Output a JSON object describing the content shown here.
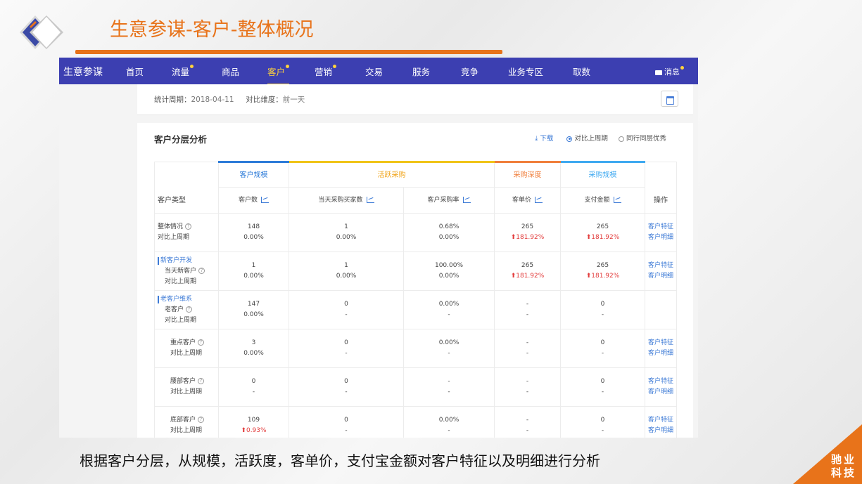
{
  "slide": {
    "title": "生意参谋-客户-整体概况",
    "caption": "根据客户分层，从规模，活跃度，客单价，支付宝金额对客户特征以及明细进行分析",
    "corner_line1": "驰业",
    "corner_line2": "科技",
    "accent_color": "#e8731a"
  },
  "nav": {
    "brand": "生意参谋",
    "items": [
      "首页",
      "流量",
      "商品",
      "客户",
      "营销",
      "交易",
      "服务",
      "竞争",
      "业务专区",
      "取数"
    ],
    "active": "客户",
    "message": "消息",
    "bg_color": "#3c3fb1"
  },
  "period": {
    "label": "统计周期：",
    "value": "2018-04-11",
    "compare_label": "对比维度：",
    "compare_value": "前一天"
  },
  "panel": {
    "title": "客户分层分析",
    "download": "下载",
    "radio_1": "对比上周期",
    "radio_2": "同行同层优秀"
  },
  "table": {
    "groups": [
      "客户规模",
      "活跃采购",
      "采购深度",
      "采购规模"
    ],
    "type_header": "客户类型",
    "ops_header": "操作",
    "columns": [
      "客户数",
      "当天采购买家数",
      "客户采购率",
      "客单价",
      "支付金额"
    ],
    "rows": [
      {
        "cat": "",
        "name": "整体情况",
        "sub": "对比上周期",
        "c1": "148",
        "c1b": "0.00%",
        "c2": "1",
        "c2b": "0.00%",
        "c3": "0.68%",
        "c3b": "0.00%",
        "c4": "265",
        "c4b": "181.92%",
        "c5": "265",
        "c5b": "181.92%",
        "op1": "客户特征",
        "op2": "客户明细"
      },
      {
        "cat": "新客户开发",
        "name": "当天新客户",
        "sub": "对比上周期",
        "c1": "1",
        "c1b": "0.00%",
        "c2": "1",
        "c2b": "0.00%",
        "c3": "100.00%",
        "c3b": "0.00%",
        "c4": "265",
        "c4b": "181.92%",
        "c5": "265",
        "c5b": "181.92%",
        "op1": "客户特征",
        "op2": "客户明细"
      },
      {
        "cat": "老客户维系",
        "name": "老客户",
        "sub": "对比上周期",
        "c1": "147",
        "c1b": "0.00%",
        "c2": "0",
        "c2b": "-",
        "c3": "0.00%",
        "c3b": "-",
        "c4": "-",
        "c4b": "-",
        "c5": "0",
        "c5b": "-",
        "op1": "",
        "op2": ""
      },
      {
        "cat": "",
        "name": "重点客户",
        "sub": "对比上周期",
        "c1": "3",
        "c1b": "0.00%",
        "c2": "0",
        "c2b": "-",
        "c3": "0.00%",
        "c3b": "-",
        "c4": "-",
        "c4b": "-",
        "c5": "0",
        "c5b": "-",
        "op1": "客户特征",
        "op2": "客户明细"
      },
      {
        "cat": "",
        "name": "腰部客户",
        "sub": "对比上周期",
        "c1": "0",
        "c1b": "-",
        "c2": "0",
        "c2b": "-",
        "c3": "-",
        "c3b": "-",
        "c4": "-",
        "c4b": "-",
        "c5": "0",
        "c5b": "-",
        "op1": "客户特征",
        "op2": "客户明细"
      },
      {
        "cat": "",
        "name": "底部客户",
        "sub": "对比上周期",
        "c1": "109",
        "c1b": "0.93%",
        "c2": "0",
        "c2b": "-",
        "c3": "0.00%",
        "c3b": "-",
        "c4": "-",
        "c4b": "-",
        "c5": "0",
        "c5b": "-",
        "op1": "客户特征",
        "op2": "客户明细"
      }
    ]
  }
}
